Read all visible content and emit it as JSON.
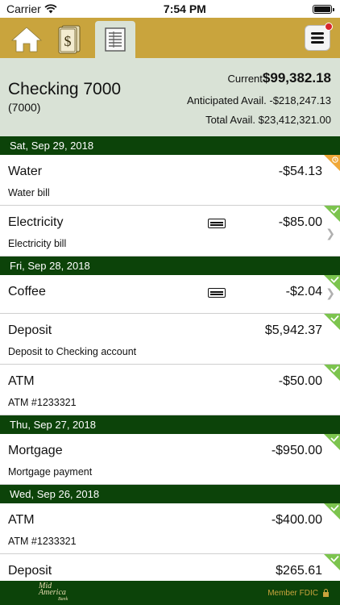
{
  "status_bar": {
    "carrier": "Carrier",
    "time": "7:54 PM"
  },
  "toolbar": {
    "tabs": [
      {
        "name": "home",
        "icon": "home-icon"
      },
      {
        "name": "transfers",
        "icon": "money-icon"
      },
      {
        "name": "register",
        "icon": "register-icon",
        "active": true
      }
    ],
    "menu_icon": "hamburger-menu-icon",
    "notification_color": "#d8262c"
  },
  "account": {
    "name": "Checking 7000",
    "number": "(7000)",
    "current_label": "Current",
    "current_value": "$99,382.18",
    "anticipated_label": "Anticipated Avail.",
    "anticipated_value": "-$218,247.13",
    "total_label": "Total Avail.",
    "total_value": "$23,412,321.00"
  },
  "groups": [
    {
      "date": "Sat, Sep 29, 2018",
      "items": [
        {
          "title": "Water",
          "subtitle": "Water bill",
          "amount": "-$54.13",
          "status": "pending"
        },
        {
          "title": "Electricity",
          "subtitle": "Electricity bill",
          "amount": "-$85.00",
          "status": "cleared",
          "card": true,
          "chevron": true
        }
      ]
    },
    {
      "date": "Fri, Sep 28, 2018",
      "items": [
        {
          "title": "Coffee",
          "subtitle": "",
          "amount": "-$2.04",
          "status": "cleared",
          "card": true,
          "chevron": true
        },
        {
          "title": "Deposit",
          "subtitle": "Deposit to Checking account",
          "amount": "$5,942.37",
          "status": "cleared"
        },
        {
          "title": "ATM",
          "subtitle": "ATM #1233321",
          "amount": "-$50.00",
          "status": "cleared"
        }
      ]
    },
    {
      "date": "Thu, Sep 27, 2018",
      "items": [
        {
          "title": "Mortgage",
          "subtitle": "Mortgage payment",
          "amount": "-$950.00",
          "status": "cleared"
        }
      ]
    },
    {
      "date": "Wed, Sep 26, 2018",
      "items": [
        {
          "title": "ATM",
          "subtitle": "ATM #1233321",
          "amount": "-$400.00",
          "status": "cleared"
        },
        {
          "title": "Deposit",
          "subtitle": "",
          "amount": "$265.61",
          "status": "cleared"
        }
      ]
    }
  ],
  "footer": {
    "logo_line1": "Mid",
    "logo_line2": "America",
    "logo_line3": "Bank",
    "fdic": "Member FDIC"
  },
  "colors": {
    "gold": "#c9a43d",
    "dark_green": "#0c4309",
    "light_green": "#d9e2d6",
    "check_green": "#7cc44e",
    "pending_orange": "#f0a838"
  }
}
